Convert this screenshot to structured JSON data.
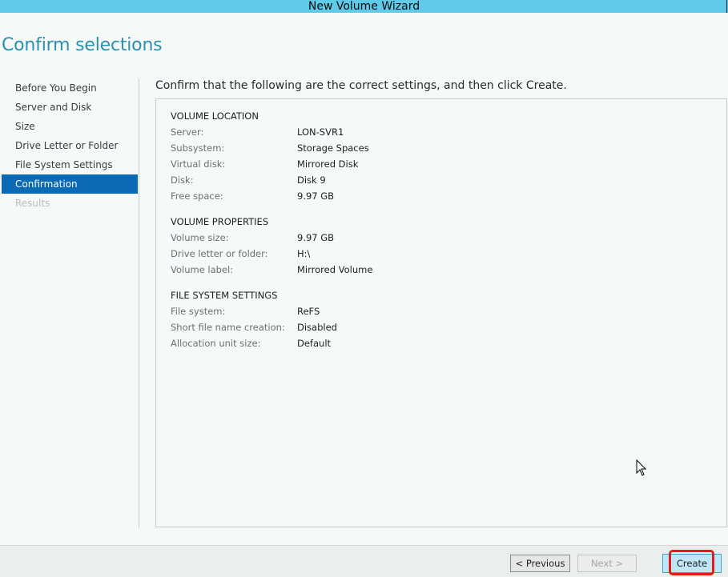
{
  "window": {
    "title": "New Volume Wizard"
  },
  "page": {
    "title": "Confirm selections",
    "instruction": "Confirm that the following are the correct settings, and then click Create."
  },
  "nav": {
    "items": [
      {
        "label": "Before You Begin",
        "state": "normal"
      },
      {
        "label": "Server and Disk",
        "state": "normal"
      },
      {
        "label": "Size",
        "state": "normal"
      },
      {
        "label": "Drive Letter or Folder",
        "state": "normal"
      },
      {
        "label": "File System Settings",
        "state": "normal"
      },
      {
        "label": "Confirmation",
        "state": "active"
      },
      {
        "label": "Results",
        "state": "disabled"
      }
    ]
  },
  "summary": {
    "volume_location": {
      "heading": "VOLUME LOCATION",
      "rows": [
        {
          "label": "Server:",
          "value": "LON-SVR1"
        },
        {
          "label": "Subsystem:",
          "value": "Storage Spaces"
        },
        {
          "label": "Virtual disk:",
          "value": "Mirrored Disk"
        },
        {
          "label": "Disk:",
          "value": "Disk 9"
        },
        {
          "label": "Free space:",
          "value": "9.97 GB"
        }
      ]
    },
    "volume_properties": {
      "heading": "VOLUME PROPERTIES",
      "rows": [
        {
          "label": "Volume size:",
          "value": "9.97 GB"
        },
        {
          "label": "Drive letter or folder:",
          "value": "H:\\"
        },
        {
          "label": "Volume label:",
          "value": "Mirrored Volume"
        }
      ]
    },
    "file_system_settings": {
      "heading": "FILE SYSTEM SETTINGS",
      "rows": [
        {
          "label": "File system:",
          "value": "ReFS"
        },
        {
          "label": "Short file name creation:",
          "value": "Disabled"
        },
        {
          "label": "Allocation unit size:",
          "value": "Default"
        }
      ]
    }
  },
  "footer": {
    "previous_label": "< Previous",
    "next_label": "Next >",
    "create_label": "Create"
  },
  "colors": {
    "accent": "#0a6ab4",
    "title_bar": "#5fcbe9",
    "page_title": "#2d8fb0",
    "highlight": "#e41b23"
  },
  "icons": {
    "cursor": "mouse-pointer-icon"
  }
}
